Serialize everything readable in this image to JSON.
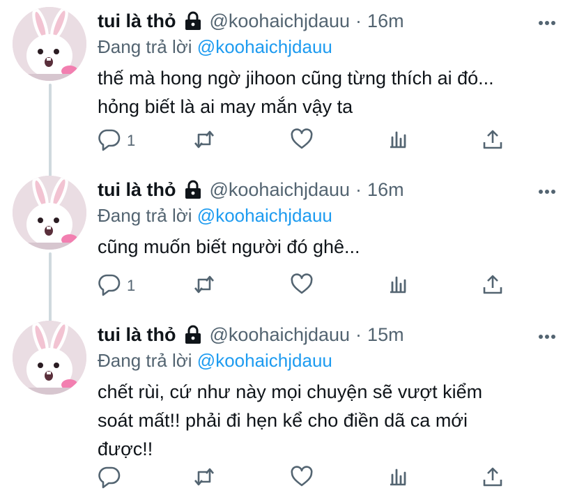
{
  "tweets": [
    {
      "display_name": "tui là thỏ",
      "handle": "@koohaichjdauu",
      "dot": "·",
      "time": "16m",
      "reply_prefix": "Đang trả lời",
      "reply_mention": "@koohaichjdauu",
      "text_lines": [
        "thế mà hong ngờ jihoon cũng từng thích ai đó...",
        "hỏng biết là ai may mắn vậy ta"
      ],
      "reply_count": "1"
    },
    {
      "display_name": "tui là thỏ",
      "handle": "@koohaichjdauu",
      "dot": "·",
      "time": "16m",
      "reply_prefix": "Đang trả lời",
      "reply_mention": "@koohaichjdauu",
      "text_lines": [
        "cũng muốn biết người đó ghê..."
      ],
      "reply_count": "1"
    },
    {
      "display_name": "tui là thỏ",
      "handle": "@koohaichjdauu",
      "dot": "·",
      "time": "15m",
      "reply_prefix": "Đang trả lời",
      "reply_mention": "@koohaichjdauu",
      "text_lines": [
        "chết rùi, cứ như này mọi chuyện sẽ vượt kiểm",
        "soát mất!! phải đi hẹn kể cho điền dã ca mới",
        "được!!"
      ],
      "reply_count": ""
    }
  ],
  "icons": {
    "lock": "lock-icon",
    "more": "more-icon",
    "reply": "reply-icon",
    "retweet": "retweet-icon",
    "like": "like-icon",
    "views": "views-icon",
    "share": "share-icon"
  },
  "colors": {
    "text": "#0f1419",
    "secondary": "#536471",
    "mention": "#1d9bf0",
    "thread_line": "#cfd9de"
  }
}
